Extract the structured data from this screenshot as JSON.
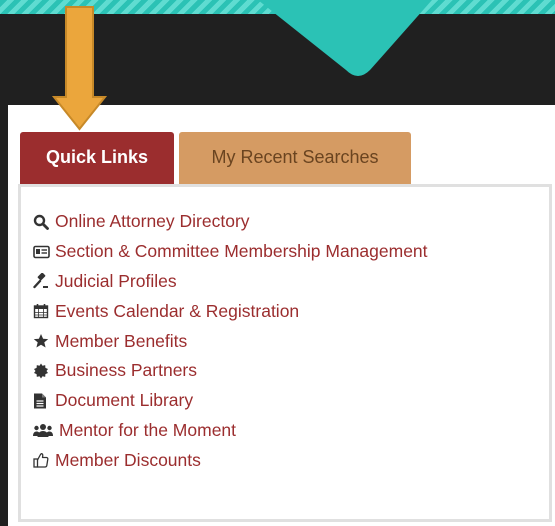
{
  "colors": {
    "accent_red": "#9b2d2e",
    "tab_tan": "#d59b63",
    "teal": "#2bc2b5",
    "arrow_orange": "#eba63c",
    "dark_bg": "#202020"
  },
  "tabs": [
    {
      "label": "Quick Links",
      "active": true
    },
    {
      "label": "My Recent Searches",
      "active": false
    }
  ],
  "quick_links": [
    {
      "label": "Online Attorney Directory",
      "icon": "search-icon"
    },
    {
      "label": "Section & Committee Membership Management",
      "icon": "id-card-icon"
    },
    {
      "label": "Judicial Profiles",
      "icon": "gavel-icon"
    },
    {
      "label": "Events Calendar & Registration",
      "icon": "calendar-icon"
    },
    {
      "label": "Member Benefits",
      "icon": "star-icon"
    },
    {
      "label": "Business Partners",
      "icon": "certificate-icon"
    },
    {
      "label": "Document Library",
      "icon": "file-text-icon"
    },
    {
      "label": "Mentor for the Moment",
      "icon": "users-icon"
    },
    {
      "label": "Member Discounts",
      "icon": "thumbs-up-icon"
    }
  ]
}
